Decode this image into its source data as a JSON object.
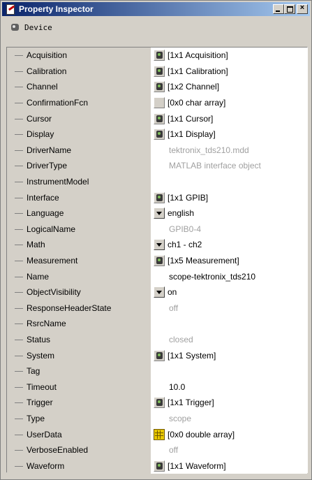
{
  "window": {
    "title": "Property Inspector",
    "buttons": {
      "minimize": "_",
      "maximize": "□",
      "close": "×"
    }
  },
  "header": {
    "object_label": "Device"
  },
  "properties": [
    {
      "name": "Acquisition",
      "value": "[1x1 Acquisition]",
      "icon": "object-icon",
      "style": "normal"
    },
    {
      "name": "Calibration",
      "value": "[1x1 Calibration]",
      "icon": "object-icon",
      "style": "normal"
    },
    {
      "name": "Channel",
      "value": "[1x2 Channel]",
      "icon": "object-icon",
      "style": "normal"
    },
    {
      "name": "ConfirmationFcn",
      "value": "[0x0  char array]",
      "icon": "blank-icon",
      "style": "normal"
    },
    {
      "name": "Cursor",
      "value": "[1x1 Cursor]",
      "icon": "object-icon",
      "style": "normal"
    },
    {
      "name": "Display",
      "value": "[1x1 Display]",
      "icon": "object-icon",
      "style": "normal"
    },
    {
      "name": "DriverName",
      "value": "tektronix_tds210.mdd",
      "icon": "",
      "style": "gray"
    },
    {
      "name": "DriverType",
      "value": "MATLAB interface object",
      "icon": "",
      "style": "gray"
    },
    {
      "name": "InstrumentModel",
      "value": "",
      "icon": "",
      "style": "plain"
    },
    {
      "name": "Interface",
      "value": "[1x1 GPIB]",
      "icon": "object-icon",
      "style": "normal"
    },
    {
      "name": "Language",
      "value": "english",
      "icon": "dropdown-icon",
      "style": "normal"
    },
    {
      "name": "LogicalName",
      "value": "GPIB0-4",
      "icon": "",
      "style": "gray"
    },
    {
      "name": "Math",
      "value": "ch1 - ch2",
      "icon": "dropdown-icon",
      "style": "normal"
    },
    {
      "name": "Measurement",
      "value": "[1x5 Measurement]",
      "icon": "object-icon",
      "style": "normal"
    },
    {
      "name": "Name",
      "value": "scope-tektronix_tds210",
      "icon": "",
      "style": "plain"
    },
    {
      "name": "ObjectVisibility",
      "value": "on",
      "icon": "dropdown-icon",
      "style": "normal"
    },
    {
      "name": "ResponseHeaderState",
      "value": "off",
      "icon": "",
      "style": "gray"
    },
    {
      "name": "RsrcName",
      "value": "",
      "icon": "",
      "style": "plain"
    },
    {
      "name": "Status",
      "value": "closed",
      "icon": "",
      "style": "gray"
    },
    {
      "name": "System",
      "value": "[1x1 System]",
      "icon": "object-icon",
      "style": "normal"
    },
    {
      "name": "Tag",
      "value": "",
      "icon": "",
      "style": "plain"
    },
    {
      "name": "Timeout",
      "value": "10.0",
      "icon": "",
      "style": "plain"
    },
    {
      "name": "Trigger",
      "value": "[1x1 Trigger]",
      "icon": "object-icon",
      "style": "normal"
    },
    {
      "name": "Type",
      "value": "scope",
      "icon": "",
      "style": "gray"
    },
    {
      "name": "UserData",
      "value": "[0x0  double array]",
      "icon": "matrix-icon",
      "style": "normal"
    },
    {
      "name": "VerboseEnabled",
      "value": "off",
      "icon": "",
      "style": "gray"
    },
    {
      "name": "Waveform",
      "value": "[1x1 Waveform]",
      "icon": "object-icon",
      "style": "normal"
    }
  ]
}
